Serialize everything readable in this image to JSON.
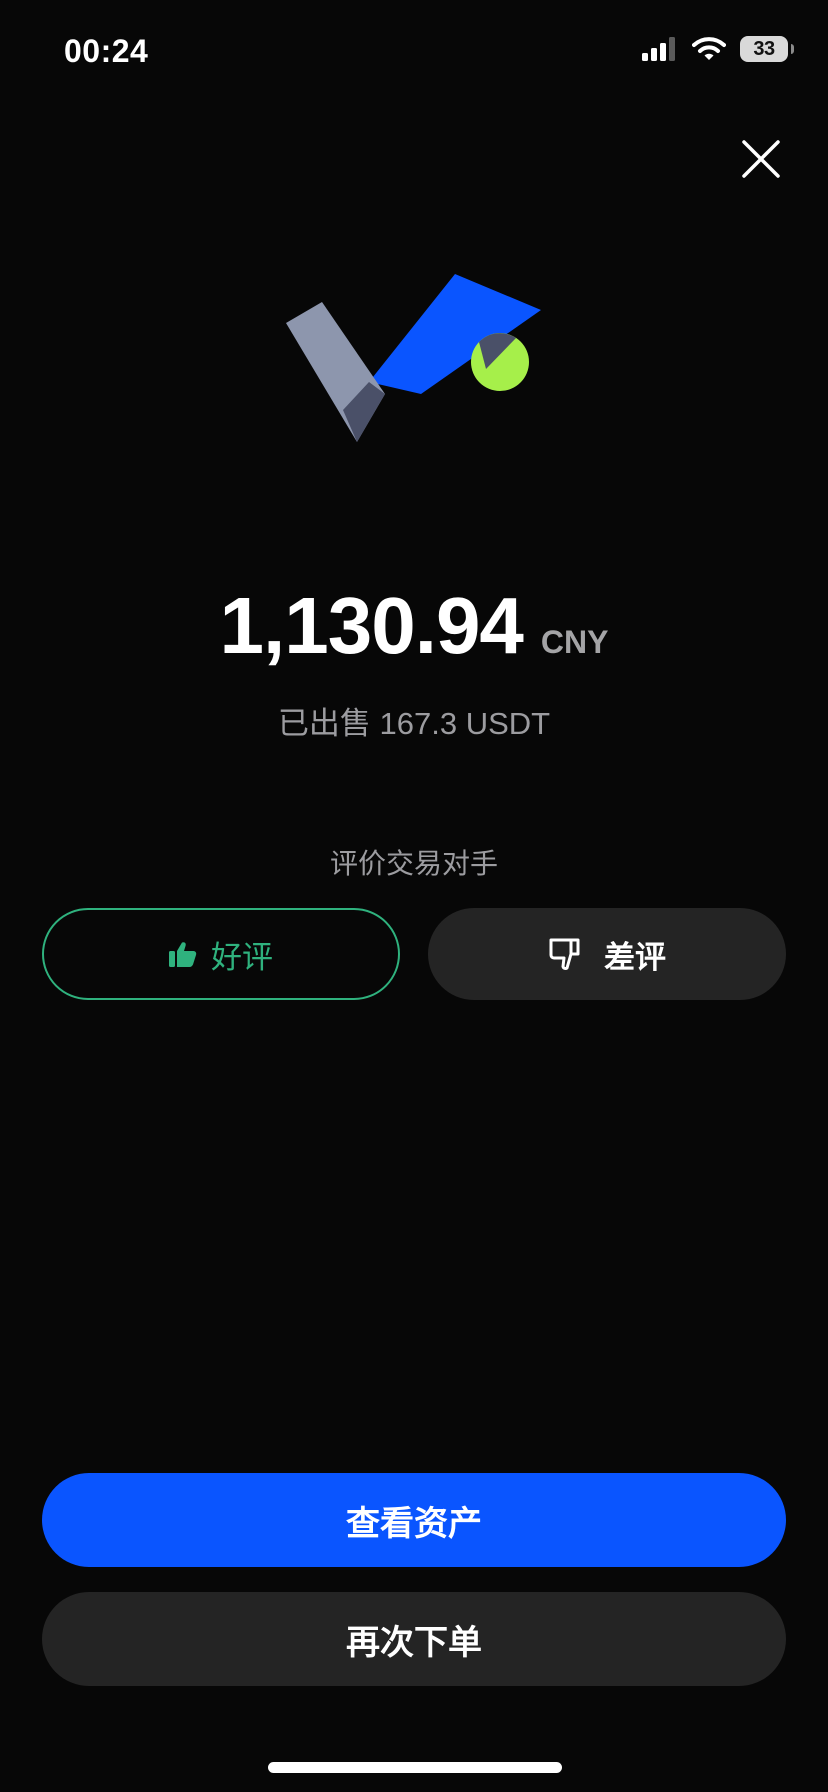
{
  "status_bar": {
    "time": "00:24",
    "battery_level": "33"
  },
  "icons": {
    "close": "close-icon",
    "success": "checkmark-illustration-icon",
    "thumbs_up": "thumbs-up-icon",
    "thumbs_down": "thumbs-down-icon",
    "signal": "cellular-signal-icon",
    "wifi": "wifi-icon",
    "battery": "battery-icon"
  },
  "summary": {
    "amount": "1,130.94",
    "currency": "CNY",
    "sold_text": "已出售 167.3 USDT"
  },
  "rating": {
    "title": "评价交易对手",
    "good_label": "好评",
    "bad_label": "差评"
  },
  "actions": {
    "view_assets_label": "查看资产",
    "order_again_label": "再次下单"
  },
  "colors": {
    "background": "#070707",
    "primary_blue": "#0a55ff",
    "positive_green": "#2fb27e",
    "secondary_button": "#242424",
    "accent_lime": "#a6ef4a",
    "muted_text": "#9c9ca0"
  }
}
